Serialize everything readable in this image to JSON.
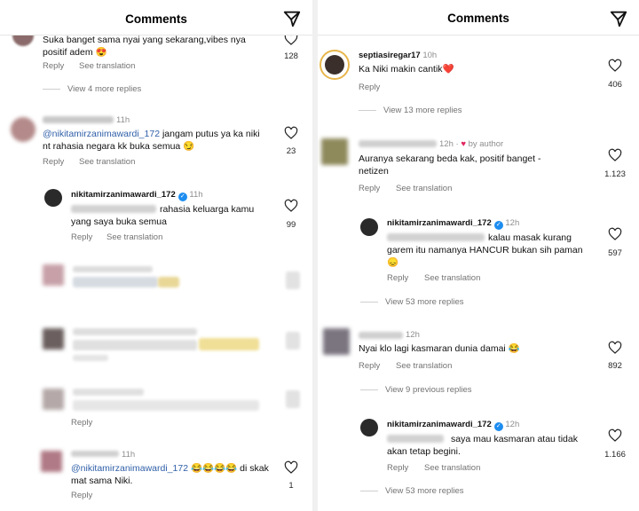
{
  "left": {
    "title": "Comments",
    "top_partial": {
      "text": "Suka banget sama nyai yang sekarang,vibes nya positif adem 😍",
      "reply": "Reply",
      "see_translation": "See translation",
      "likes": "128",
      "view_more": "View 4 more replies"
    },
    "c2": {
      "time": "11h",
      "mention": "@nikitamirzanimawardi_172",
      "text": " jangam putus ya ka niki nt rahasia negara kk buka semua 😏",
      "reply": "Reply",
      "see_translation": "See translation",
      "likes": "23"
    },
    "c3": {
      "username": "nikitamirzanimawardi_172",
      "time": "11h",
      "text": "rahasia keluarga kamu yang saya buka semua",
      "reply": "Reply",
      "see_translation": "See translation",
      "likes": "99"
    },
    "c4_reply": "Reply",
    "c5": {
      "time": "11h",
      "mention": "@nikitamirzanimawardi_172",
      "text": " 😂😂😂😂 di skak mat sama Niki.",
      "reply": "Reply",
      "likes": "1"
    }
  },
  "right": {
    "title": "Comments",
    "r1": {
      "username": "septiasiregar17",
      "time": "10h",
      "text": "Ka Niki makin cantik❤️",
      "reply": "Reply",
      "likes": "406",
      "view_more": "View 13 more replies"
    },
    "r2": {
      "time": "12h",
      "by_author": "by author",
      "text": "Auranya sekarang beda kak, positif banget - netizen",
      "reply": "Reply",
      "see_translation": "See translation",
      "likes": "1.123"
    },
    "r3": {
      "username": "nikitamirzanimawardi_172",
      "time": "12h",
      "text": "kalau masak kurang garem itu namanya HANCUR bukan sih paman 😞",
      "reply": "Reply",
      "see_translation": "See translation",
      "likes": "597",
      "view_more": "View 53 more replies"
    },
    "r4": {
      "time": "12h",
      "text": "Nyai klo lagi kasmaran dunia damai 😂",
      "reply": "Reply",
      "see_translation": "See translation",
      "likes": "892",
      "view_prev": "View 9 previous replies"
    },
    "r5": {
      "username": "nikitamirzanimawardi_172",
      "time": "12h",
      "text": "saya mau kasmaran atau tidak akan tetap begini.",
      "reply": "Reply",
      "see_translation": "See translation",
      "likes": "1.166",
      "view_more": "View 53 more replies"
    }
  },
  "colors": {
    "mention": "#2f5fa8",
    "verified": "#1d8df0",
    "heart_red": "#e0245e",
    "muted": "#737373"
  }
}
